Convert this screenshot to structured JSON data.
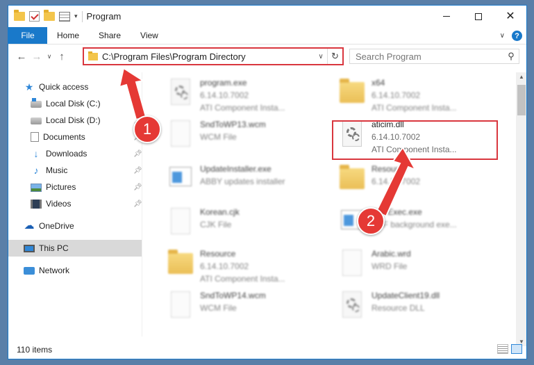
{
  "window": {
    "title": "Program",
    "controls": {
      "minimize": "minimize",
      "maximize": "maximize",
      "close": "✕"
    }
  },
  "ribbon": {
    "tabs": [
      "File",
      "Home",
      "Share",
      "View"
    ],
    "help": "?"
  },
  "address": {
    "path": "C:\\Program Files\\Program Directory",
    "search_placeholder": "Search Program"
  },
  "nav_pane": {
    "items": [
      {
        "label": "Quick access",
        "icon": "star-icon"
      },
      {
        "label": "Local Disk (C:)",
        "icon": "local-disk-icon",
        "pinned": true
      },
      {
        "label": "Local Disk (D:)",
        "icon": "local-disk-icon",
        "pinned": true
      },
      {
        "label": "Documents",
        "icon": "documents-icon",
        "pinned": true
      },
      {
        "label": "Downloads",
        "icon": "downloads-icon",
        "pinned": true
      },
      {
        "label": "Music",
        "icon": "music-icon",
        "pinned": true
      },
      {
        "label": "Pictures",
        "icon": "pictures-icon",
        "pinned": true
      },
      {
        "label": "Videos",
        "icon": "videos-icon",
        "pinned": true
      },
      {
        "label": "OneDrive",
        "icon": "onedrive-icon"
      },
      {
        "label": "This PC",
        "icon": "this-pc-icon",
        "selected": true
      },
      {
        "label": "Network",
        "icon": "network-icon"
      }
    ]
  },
  "files": [
    {
      "name": "program.exe",
      "line2": "6.14.10.7002",
      "line3": "ATI Component Insta...",
      "icon": "gear-file-icon"
    },
    {
      "name": "x64",
      "line2": "6.14.10.7002",
      "line3": "ATI Component Insta...",
      "icon": "folder-icon"
    },
    {
      "name": "SndToWP13.wcm",
      "line2": "WCM File",
      "line3": "",
      "icon": "blank-file-icon"
    },
    {
      "name": "aticim.dll",
      "line2": "6.14.10.7002",
      "line3": "ATI Component Insta...",
      "icon": "dll-file-icon",
      "highlighted": true
    },
    {
      "name": "UpdateInstaller.exe",
      "line2": "ABBY updates installer",
      "line3": "",
      "icon": "exe-file-icon"
    },
    {
      "name": "Resource",
      "line2": "6.14.10.7002",
      "line3": "",
      "icon": "folder-icon"
    },
    {
      "name": "Korean.cjk",
      "line2": "CJK File",
      "line3": "",
      "icon": "blank-file-icon"
    },
    {
      "name": "FineExec.exe",
      "line2": "PDF background exe...",
      "line3": "",
      "icon": "exe-file-icon"
    },
    {
      "name": "Resource",
      "line2": "6.14.10.7002",
      "line3": "ATI Component Insta...",
      "icon": "folder-icon"
    },
    {
      "name": "Arabic.wrd",
      "line2": "WRD File",
      "line3": "",
      "icon": "blank-file-icon"
    },
    {
      "name": "SndToWP14.wcm",
      "line2": "WCM File",
      "line3": "",
      "icon": "blank-file-icon"
    },
    {
      "name": "UpdateClient19.dll",
      "line2": "Resource DLL",
      "line3": "",
      "icon": "gear-file-icon"
    }
  ],
  "status": {
    "item_count": "110 items"
  },
  "annotations": [
    {
      "number": "1"
    },
    {
      "number": "2"
    }
  ],
  "colors": {
    "accent": "#1979ca",
    "highlight": "#d9363e",
    "callout": "#e53935"
  }
}
